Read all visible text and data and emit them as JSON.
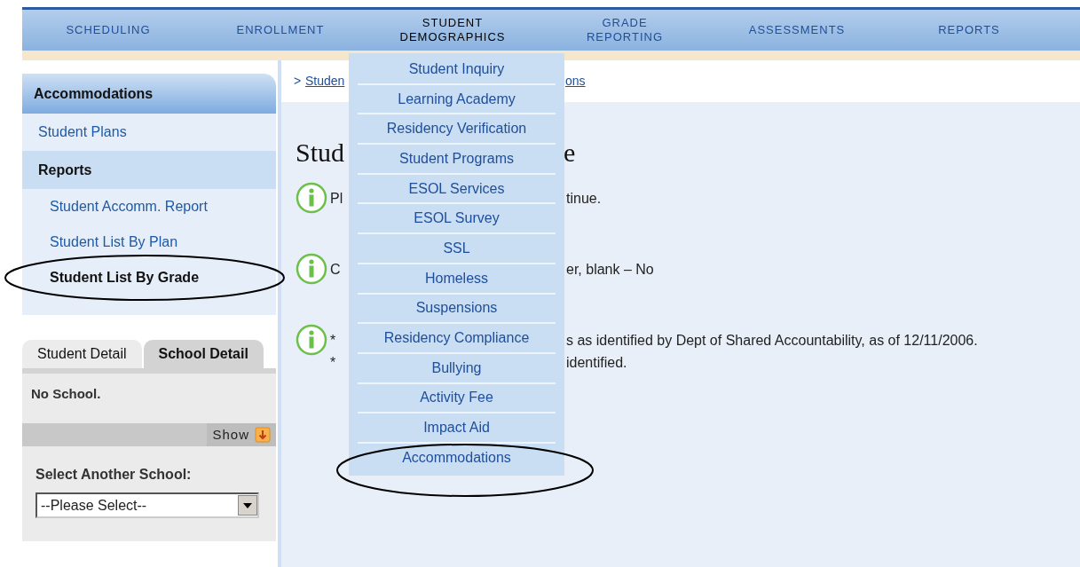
{
  "nav": {
    "items": [
      {
        "lines": [
          "SCHEDULING"
        ],
        "selected": false
      },
      {
        "lines": [
          "ENROLLMENT"
        ],
        "selected": false
      },
      {
        "lines": [
          "STUDENT",
          "DEMOGRAPHICS"
        ],
        "selected": true
      },
      {
        "lines": [
          "GRADE",
          "REPORTING"
        ],
        "selected": false
      },
      {
        "lines": [
          "ASSESSMENTS"
        ],
        "selected": false
      },
      {
        "lines": [
          "REPORTS"
        ],
        "selected": false
      }
    ]
  },
  "dropdown": {
    "items": [
      "Student Inquiry",
      "Learning Academy",
      "Residency Verification",
      "Student Programs",
      "ESOL Services",
      "ESOL Survey",
      "SSL",
      "Homeless",
      "Suspensions",
      "Residency Compliance",
      "Bullying",
      "Activity Fee",
      "Impact Aid",
      "Accommodations"
    ]
  },
  "sidebar": {
    "title": "Accommodations",
    "items": [
      {
        "kind": "link",
        "label": "Student Plans",
        "selected": false
      },
      {
        "kind": "header",
        "label": "Reports"
      },
      {
        "kind": "sublink",
        "label": "Student Accomm. Report",
        "selected": false
      },
      {
        "kind": "sublink",
        "label": "Student List By Plan",
        "selected": false
      },
      {
        "kind": "sublink",
        "label": "Student List By Grade",
        "selected": true
      }
    ]
  },
  "detail": {
    "tabs": [
      {
        "label": "Student Detail",
        "selected": false
      },
      {
        "label": "School Detail",
        "selected": true
      }
    ],
    "message": "No School.",
    "show_button": "Show",
    "select_label": "Select Another School:",
    "select_value": "--Please Select--"
  },
  "content": {
    "breadcrumb": {
      "marker": ">",
      "link_start": "Studen",
      "link_end": "ons"
    },
    "title": {
      "start": "Stud",
      "end": "e"
    },
    "messages": [
      {
        "lines": [
          {
            "start": "Pl",
            "end": "tinue."
          }
        ]
      },
      {
        "lines": [
          {
            "start": "C",
            "end": "er, blank – No"
          }
        ]
      },
      {
        "lines": [
          {
            "start": "*",
            "end": "s as identified by Dept of Shared Accountability, as of 12/11/2006."
          },
          {
            "start": "*",
            "end": "identified."
          }
        ]
      }
    ]
  }
}
